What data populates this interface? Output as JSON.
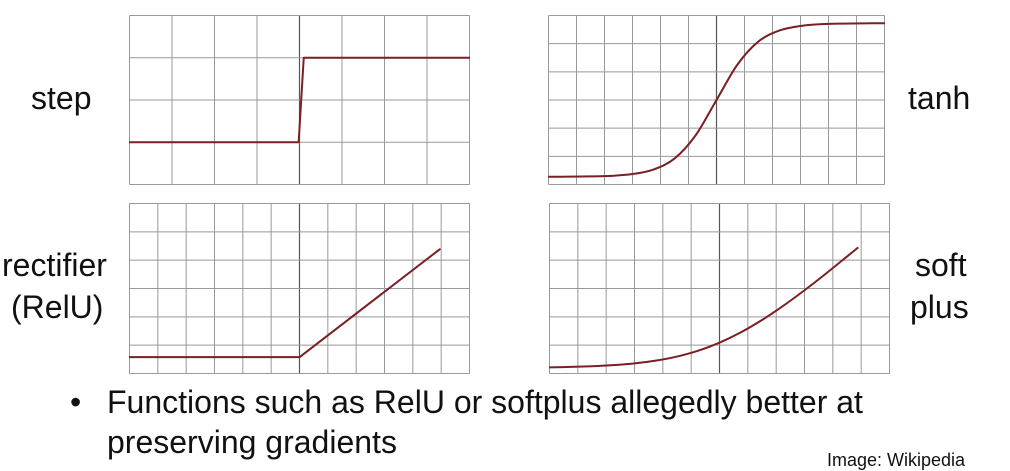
{
  "labels": {
    "step": "step",
    "tanh": "tanh",
    "rectifier_line1": "rectifier",
    "rectifier_line2": "(RelU)",
    "softplus_line1": "soft",
    "softplus_line2": "plus"
  },
  "bullet": {
    "marker": "•",
    "text": "Functions such as RelU or softplus allegedly better at preserving gradients"
  },
  "credit": "Image: Wikipedia",
  "colors": {
    "curve": "#7a1f24",
    "grid": "#999999",
    "center_axis": "#555555"
  },
  "chart_data": [
    {
      "type": "line",
      "function": "step",
      "label": "step",
      "grid": true,
      "xlim": [
        -4,
        4
      ],
      "ylim": [
        -0.5,
        1.5
      ],
      "series": [
        {
          "x": [
            -4,
            -0.02,
            0.1,
            4
          ],
          "y": [
            0,
            0,
            1,
            1
          ]
        }
      ]
    },
    {
      "type": "line",
      "function": "tanh",
      "label": "tanh",
      "grid": true,
      "xlim": [
        -4,
        4
      ],
      "ylim": [
        -1.1,
        1.1
      ],
      "series": [
        {
          "x": [
            -4,
            -3.5,
            -3,
            -2.5,
            -2,
            -1.5,
            -1,
            -0.5,
            0,
            0.5,
            1,
            1.5,
            2,
            2.5,
            3,
            3.5,
            4
          ],
          "y": [
            -0.999,
            -0.998,
            -0.995,
            -0.987,
            -0.964,
            -0.905,
            -0.762,
            -0.462,
            0,
            0.462,
            0.762,
            0.905,
            0.964,
            0.987,
            0.995,
            0.998,
            0.999
          ]
        }
      ]
    },
    {
      "type": "line",
      "function": "relu",
      "label": "rectifier (RelU)",
      "grid": true,
      "xlim": [
        -4,
        4
      ],
      "ylim": [
        -0.5,
        4.7
      ],
      "series": [
        {
          "x": [
            -4,
            0,
            3.3
          ],
          "y": [
            0,
            0,
            3.3
          ]
        }
      ]
    },
    {
      "type": "line",
      "function": "softplus",
      "label": "soft plus",
      "grid": true,
      "xlim": [
        -4,
        4
      ],
      "ylim": [
        -0.15,
        4.5
      ],
      "series": [
        {
          "x": [
            -4,
            -3.5,
            -3,
            -2.5,
            -2,
            -1.5,
            -1,
            -0.5,
            0,
            0.5,
            1,
            1.5,
            2,
            2.5,
            3,
            3.25
          ],
          "y": [
            0.018,
            0.03,
            0.049,
            0.079,
            0.127,
            0.201,
            0.313,
            0.474,
            0.693,
            0.974,
            1.313,
            1.701,
            2.127,
            2.579,
            3.049,
            3.286
          ]
        }
      ]
    }
  ]
}
